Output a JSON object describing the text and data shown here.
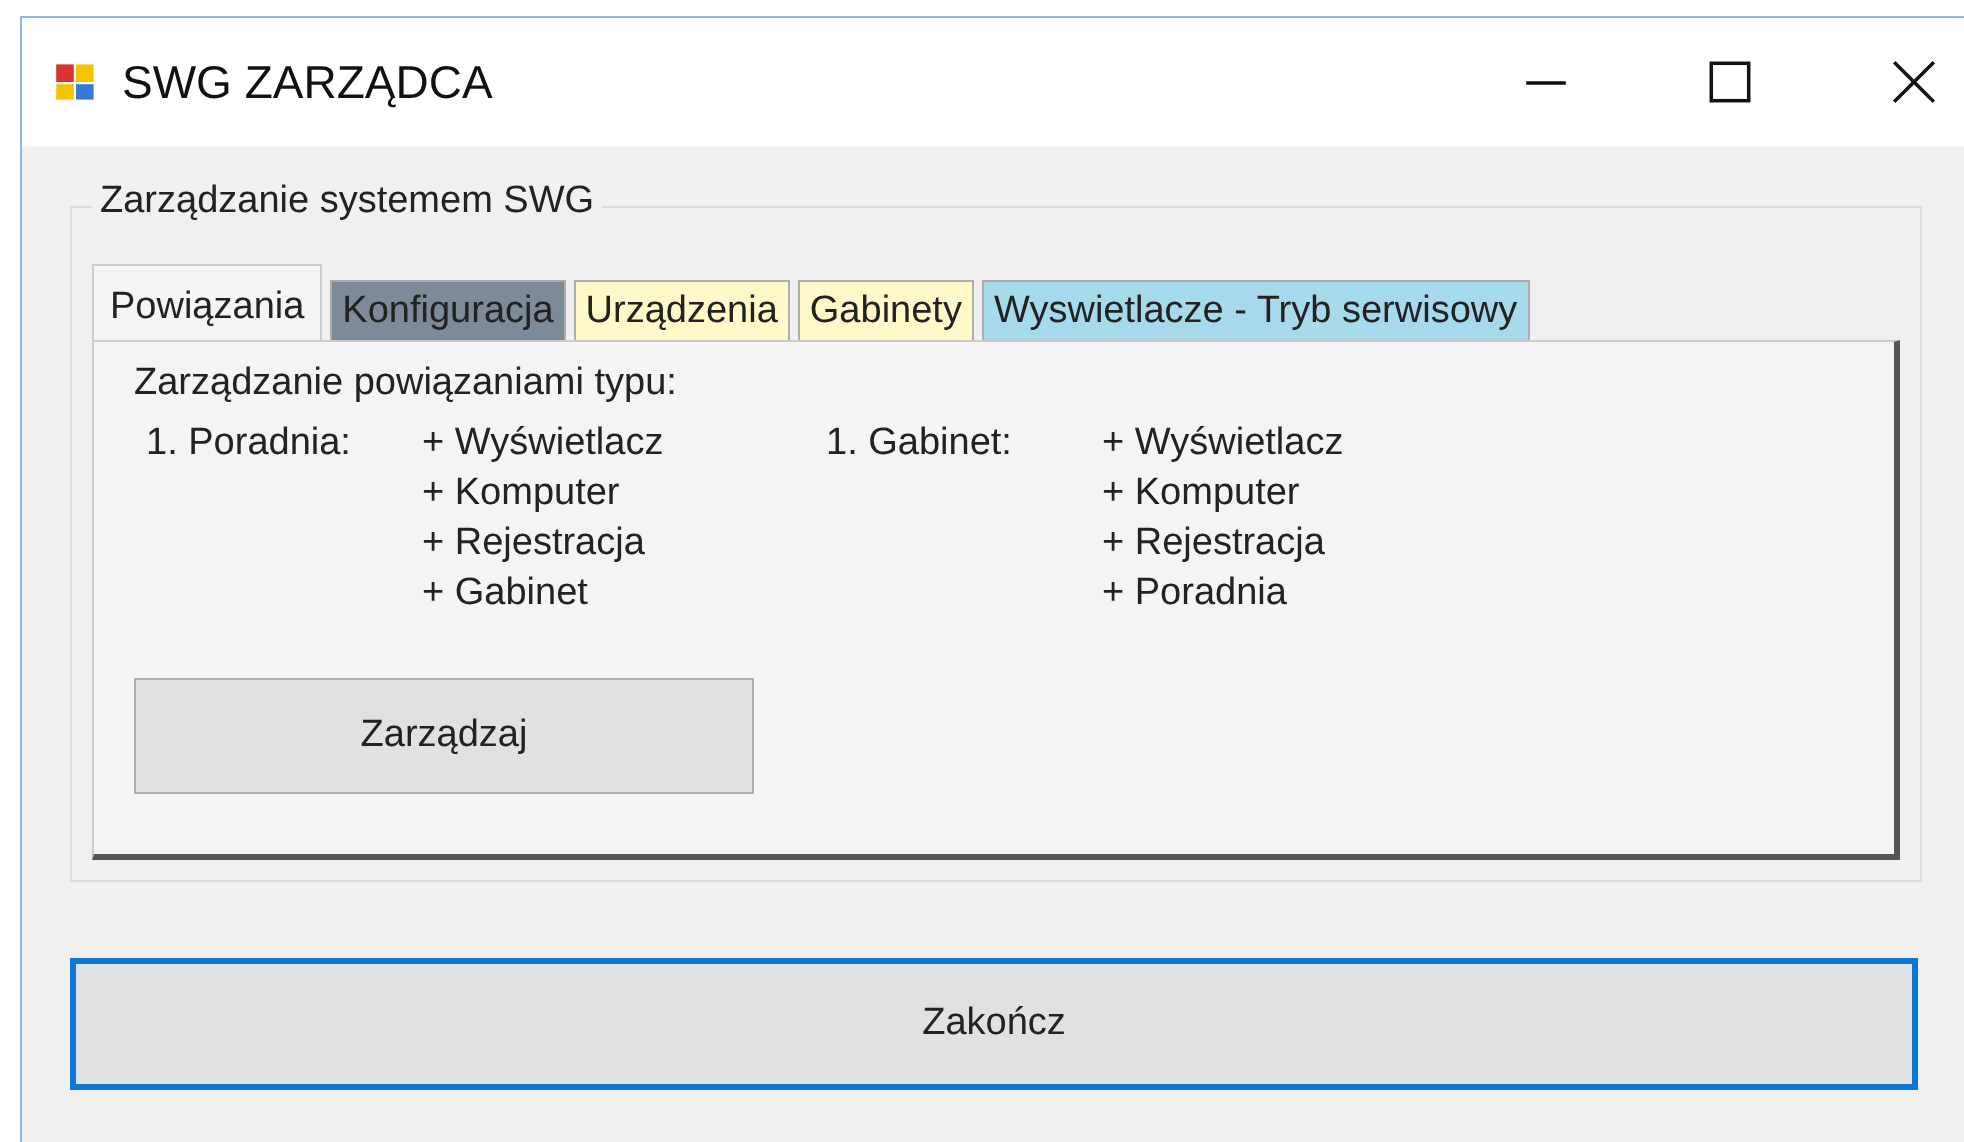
{
  "window": {
    "title": "SWG ZARZĄDCA"
  },
  "group": {
    "legend": "Zarządzanie systemem SWG"
  },
  "tabs": [
    {
      "label": "Powiązania",
      "selected": true,
      "color": "#f4f4f4"
    },
    {
      "label": "Konfiguracja",
      "selected": false,
      "color": "#7d8a9a"
    },
    {
      "label": "Urządzenia",
      "selected": false,
      "color": "#fff8c8"
    },
    {
      "label": "Gabinety",
      "selected": false,
      "color": "#fff8c8"
    },
    {
      "label": "Wyswietlacze - Tryb serwisowy",
      "selected": false,
      "color": "#a6d9ea"
    }
  ],
  "panel": {
    "heading": "Zarządzanie powiązaniami typu:",
    "relations": [
      {
        "label": "1. Poradnia:",
        "items": [
          "+ Wyświetlacz",
          "+ Komputer",
          "+ Rejestracja",
          "+ Gabinet"
        ]
      },
      {
        "label": "1. Gabinet:",
        "items": [
          "+ Wyświetlacz",
          "+ Komputer",
          "+ Rejestracja",
          "+ Poradnia"
        ]
      }
    ],
    "button": "Zarządzaj"
  },
  "buttons": [
    {
      "label": "Zakończ",
      "focused": true
    }
  ]
}
